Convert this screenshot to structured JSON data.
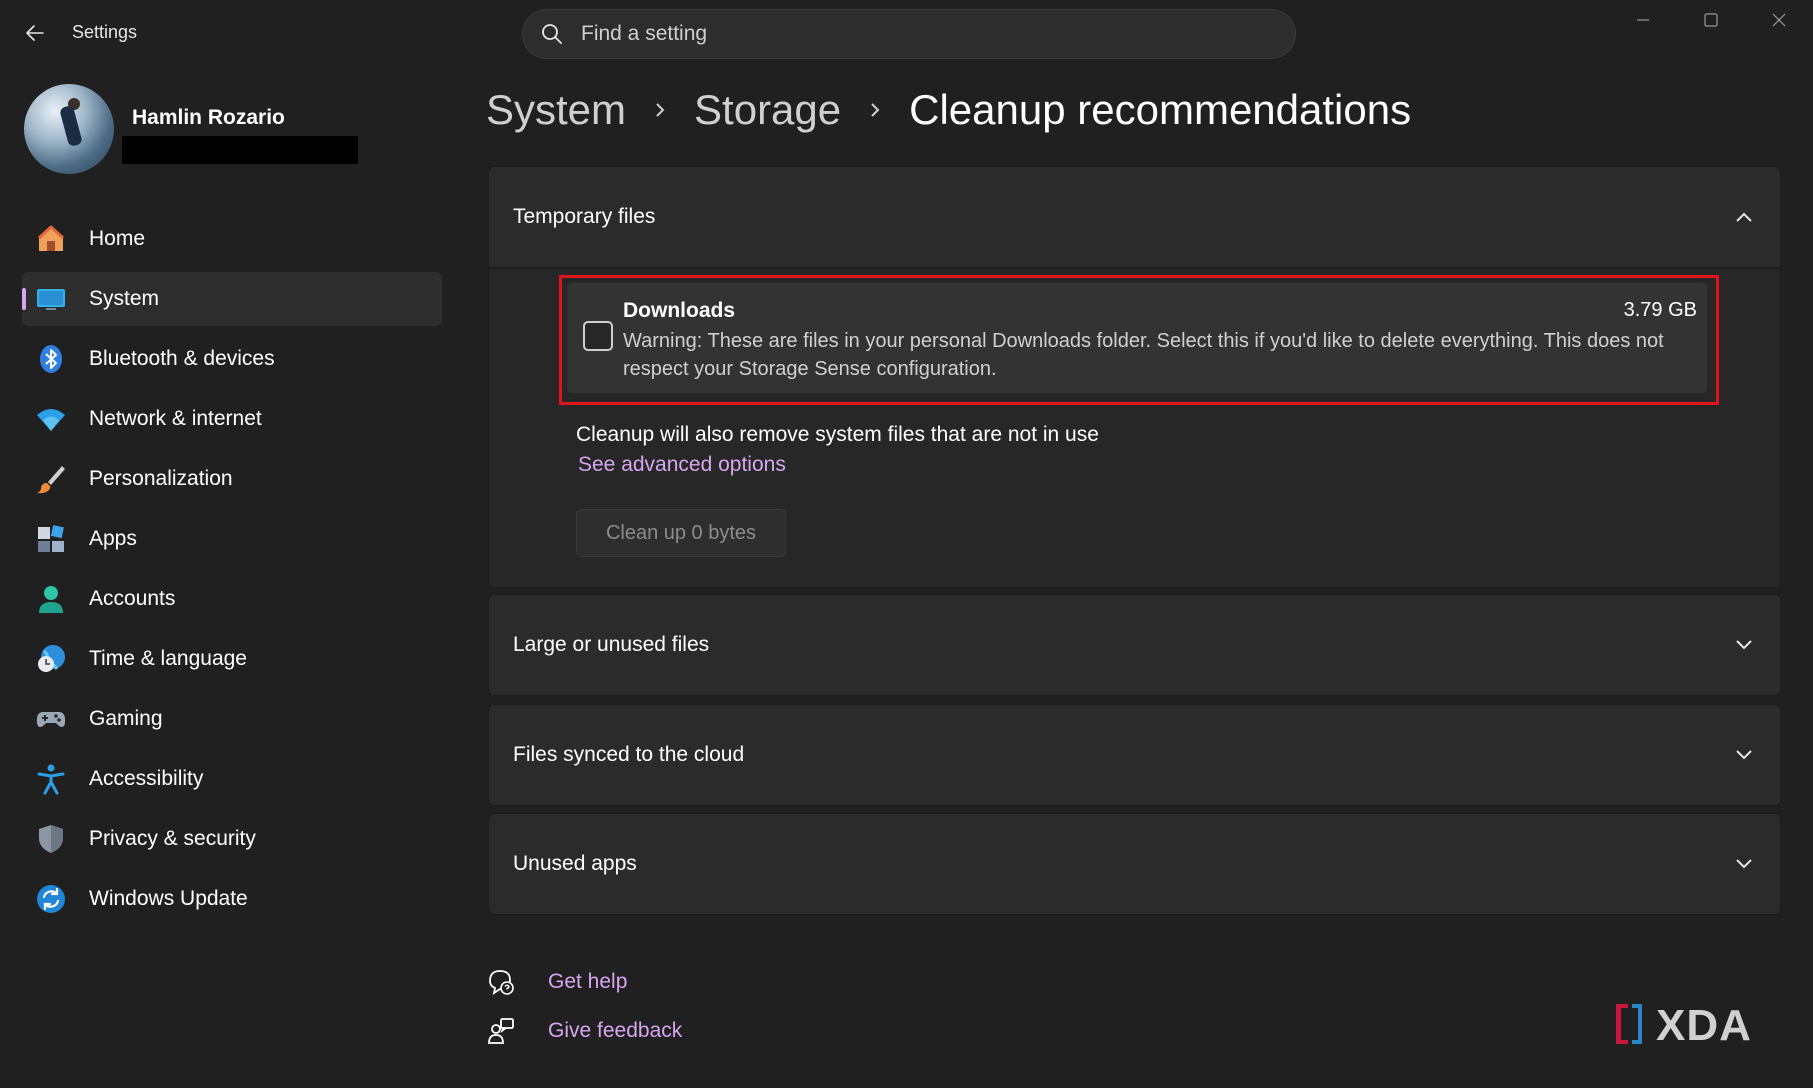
{
  "window": {
    "title": "Settings",
    "controls": [
      "minimize",
      "maximize",
      "close"
    ]
  },
  "search": {
    "placeholder": "Find a setting"
  },
  "profile": {
    "name": "Hamlin Rozario"
  },
  "nav": {
    "items": [
      {
        "label": "Home",
        "icon": "home-icon",
        "active": false
      },
      {
        "label": "System",
        "icon": "system-icon",
        "active": true
      },
      {
        "label": "Bluetooth & devices",
        "icon": "bluetooth-icon",
        "active": false
      },
      {
        "label": "Network & internet",
        "icon": "wifi-icon",
        "active": false
      },
      {
        "label": "Personalization",
        "icon": "brush-icon",
        "active": false
      },
      {
        "label": "Apps",
        "icon": "apps-icon",
        "active": false
      },
      {
        "label": "Accounts",
        "icon": "account-icon",
        "active": false
      },
      {
        "label": "Time & language",
        "icon": "globe-clock-icon",
        "active": false
      },
      {
        "label": "Gaming",
        "icon": "controller-icon",
        "active": false
      },
      {
        "label": "Accessibility",
        "icon": "accessibility-icon",
        "active": false
      },
      {
        "label": "Privacy & security",
        "icon": "shield-icon",
        "active": false
      },
      {
        "label": "Windows Update",
        "icon": "update-icon",
        "active": false
      }
    ]
  },
  "breadcrumb": {
    "items": [
      "System",
      "Storage",
      "Cleanup recommendations"
    ]
  },
  "sections": {
    "temporary": {
      "title": "Temporary files",
      "expanded": true,
      "downloads": {
        "title": "Downloads",
        "size": "3.79 GB",
        "warning": "Warning: These are files in your personal Downloads folder. Select this if you'd like to delete everything. This does not respect your Storage Sense configuration.",
        "checked": false
      },
      "also_text": "Cleanup will also remove system files that are not in use",
      "advanced_link": "See advanced options",
      "cleanup_button": "Clean up 0 bytes"
    },
    "collapsed": [
      {
        "title": "Large or unused files"
      },
      {
        "title": "Files synced to the cloud"
      },
      {
        "title": "Unused apps"
      }
    ]
  },
  "help": {
    "get_help": "Get help",
    "give_feedback": "Give feedback"
  },
  "watermark": {
    "text": "XDA"
  },
  "colors": {
    "background": "#202020",
    "accent": "#d7a6f0",
    "highlight_border": "#e0151b",
    "panel": "#2b2b2b"
  }
}
